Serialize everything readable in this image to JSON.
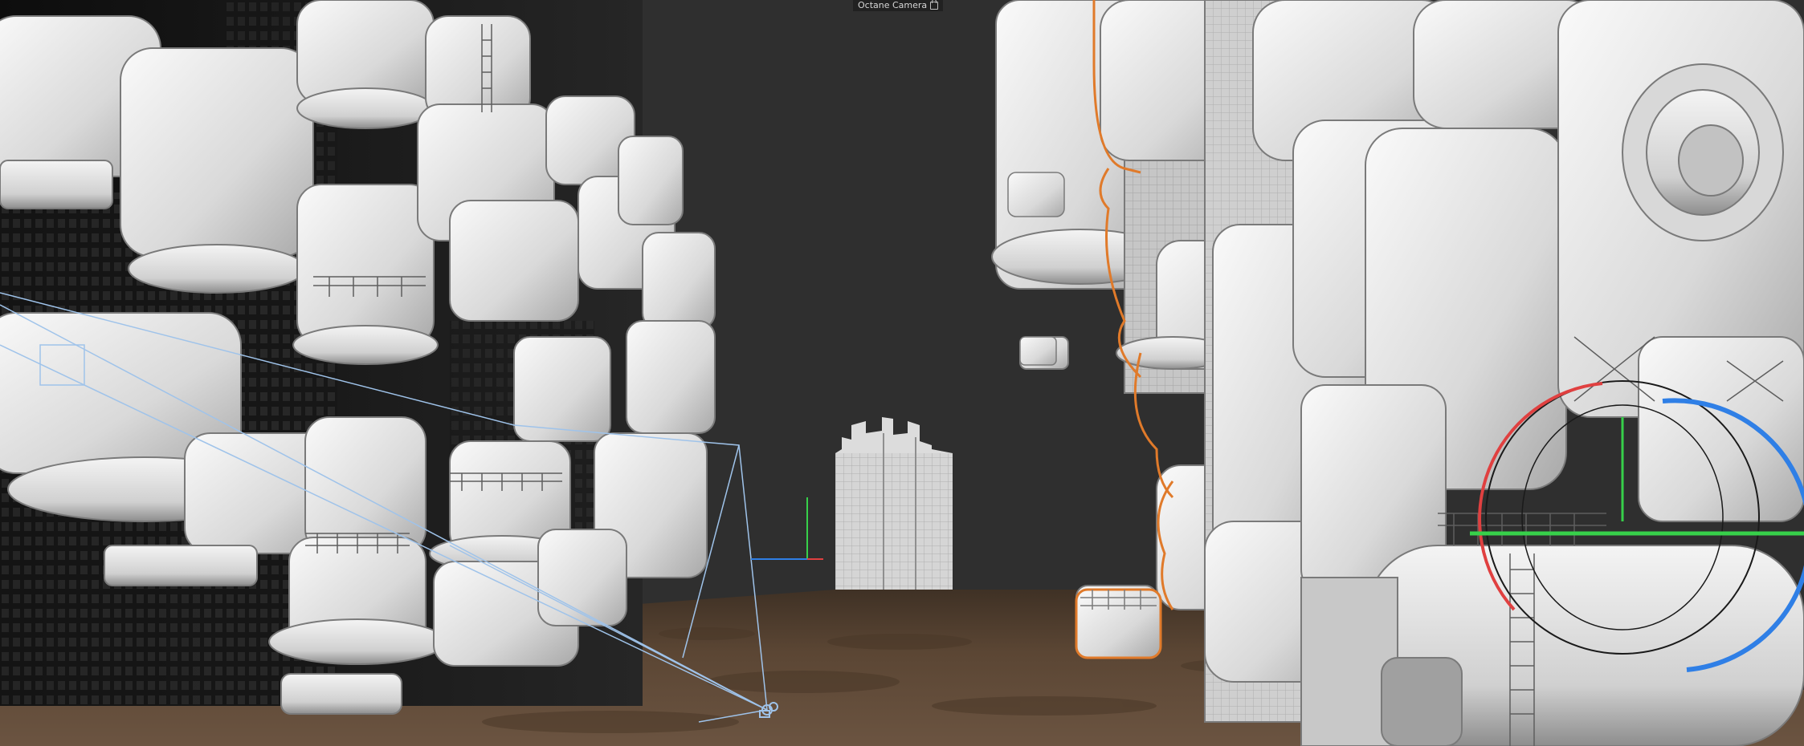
{
  "viewport": {
    "camera_label": "Octane Camera",
    "camera_icon": "lock-icon",
    "colors": {
      "background": "#2f2f2f",
      "ground": "#5b4634",
      "model": "#e6e6e6",
      "selection_outline": "#e07a2a",
      "camera_wire": "#9fc3ea",
      "axis_x": "#e04040",
      "axis_y": "#37d04a",
      "axis_z": "#2f7fe6"
    }
  }
}
